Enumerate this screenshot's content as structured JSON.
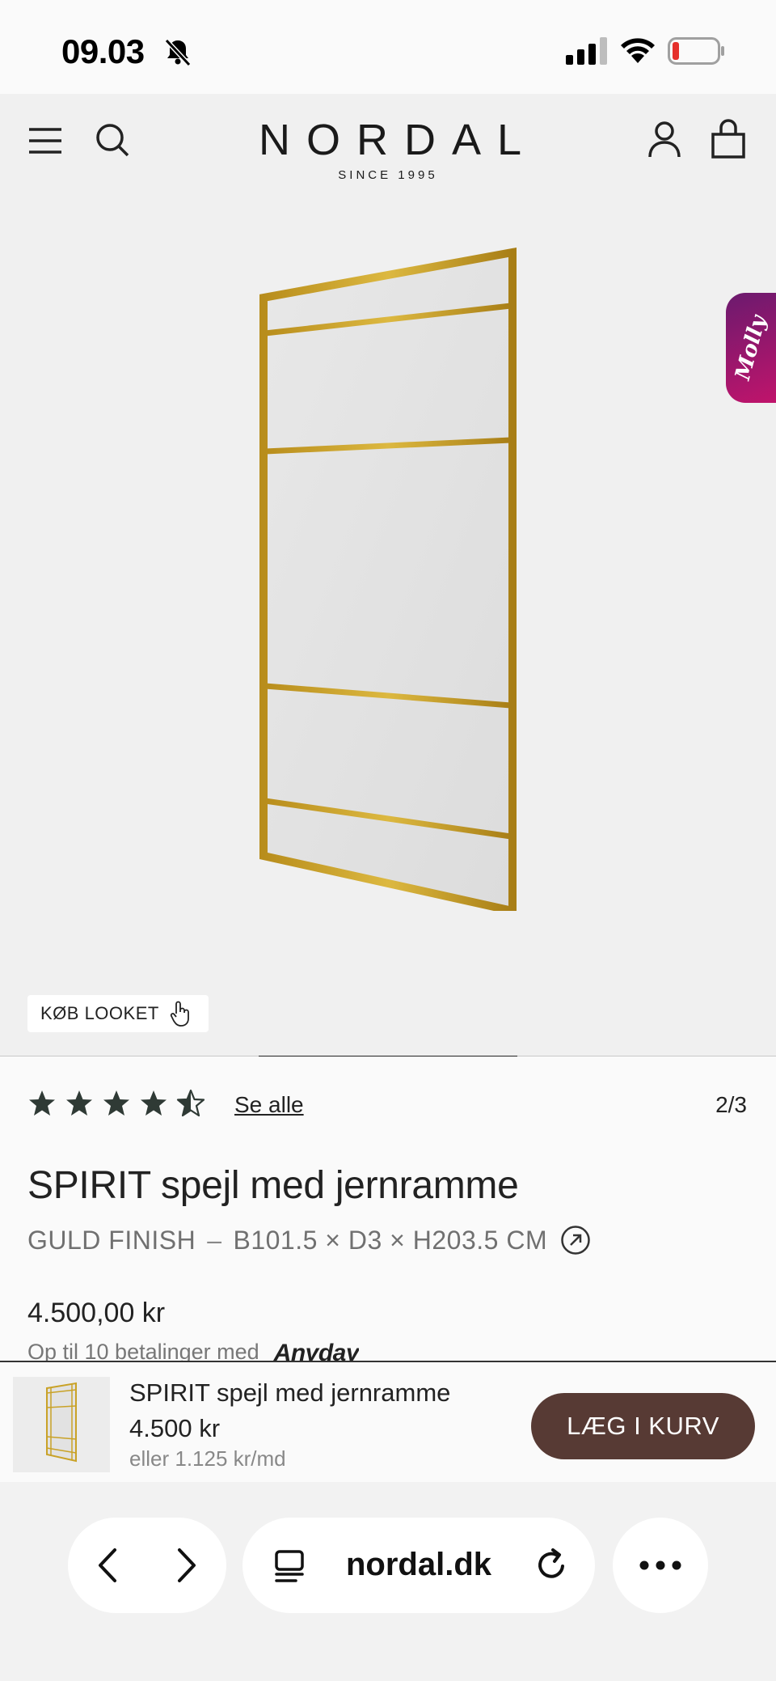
{
  "status_bar": {
    "time": "09.03",
    "icons": [
      "bell-slash-icon",
      "cellular-signal-icon",
      "wifi-icon",
      "battery-low-icon"
    ]
  },
  "header": {
    "brand": "NORDAL",
    "tagline": "SINCE 1995",
    "icons": [
      "menu-icon",
      "search-icon",
      "account-icon",
      "bag-icon"
    ]
  },
  "gallery": {
    "chat_widget_label": "Molly",
    "buy_look_label": "KØB LOOKET",
    "progress_fraction": 0.333
  },
  "product": {
    "rating": 4.5,
    "rating_max": 5,
    "see_all_label": "Se alle",
    "image_counter": "2/3",
    "title": "SPIRIT spejl med jernramme",
    "finish": "GULD FINISH",
    "separator": "–",
    "dimensions": "B101.5 × D3 × H203.5 CM",
    "price": "4.500,00 kr",
    "installments_text": "Op til 10 betalinger med",
    "installments_provider": "Anyday"
  },
  "sticky_bar": {
    "title": "SPIRIT spejl med jernramme",
    "price": "4.500 kr",
    "monthly": "eller 1.125 kr/md",
    "add_to_cart_label": "LÆG I KURV"
  },
  "browser": {
    "url": "nordal.dk",
    "icons": [
      "back-icon",
      "forward-icon",
      "tabs-icon",
      "reload-icon",
      "more-icon"
    ]
  },
  "colors": {
    "gold_frame": "#c9a227",
    "cart_button": "#573a34",
    "molly_gradient_start": "#6b1a6e",
    "molly_gradient_end": "#c0146b"
  }
}
